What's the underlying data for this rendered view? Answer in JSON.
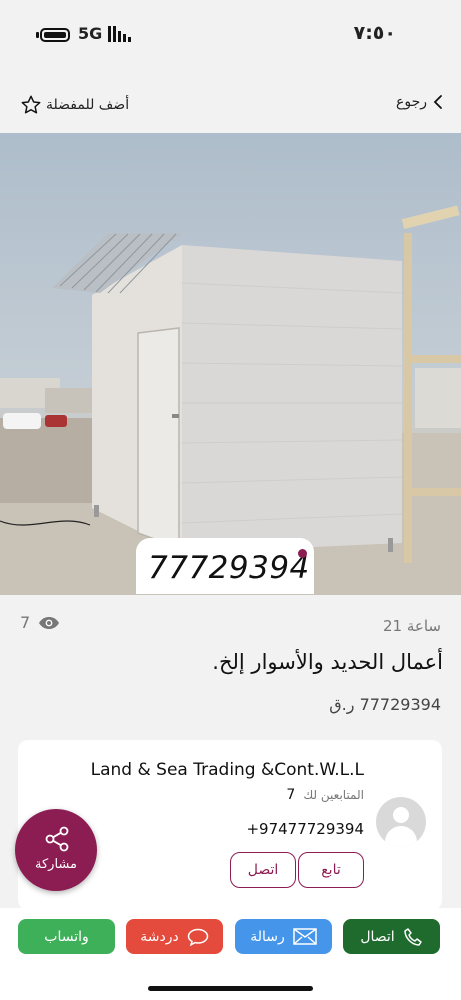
{
  "status": {
    "network": "5G",
    "time": "٧:٥٠"
  },
  "nav": {
    "favorite_label": "أضف للمفضلة",
    "back_label": "رجوع"
  },
  "listing": {
    "image_phone": "77729394",
    "views": "7",
    "age": "21 ساعة",
    "title": "أعمال الحديد والأسوار إلخ.",
    "price": "77729394 ر.ق"
  },
  "seller": {
    "name": "Land & Sea Trading &Cont.W.L.L",
    "followers_label": "المتابعين لك",
    "followers_count": "7",
    "phone": "+97477729394",
    "follow_label": "تابع",
    "call_label": "اتصل"
  },
  "share": {
    "label": "مشاركة"
  },
  "actions": {
    "whatsapp": "واتساب",
    "chat": "دردشة",
    "message": "رسالة",
    "call": "اتصال"
  },
  "colors": {
    "accent": "#8c1d52",
    "whatsapp": "#3fb05a",
    "chat": "#e54b3c",
    "message": "#4595ea",
    "call": "#1f6b2d"
  }
}
